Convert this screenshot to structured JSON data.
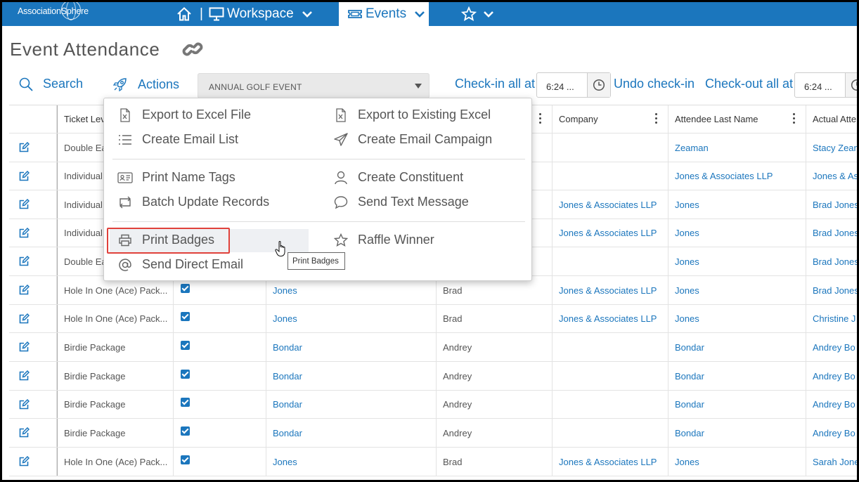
{
  "app": {
    "logo": "AssociationSphere"
  },
  "nav": {
    "workspace": "Workspace",
    "events": "Events",
    "colors": {
      "bar": "#1b76bd",
      "accent": "#1b76bd",
      "highlight": "#e0413b"
    }
  },
  "page": {
    "title": "Event Attendance"
  },
  "toolbar": {
    "search": "Search",
    "actions": "Actions",
    "event": "ANNUAL GOLF EVENT",
    "checkin_all": "Check-in all at",
    "checkin_time": "6:24 ...",
    "undo_checkin": "Undo check-in",
    "checkout_all": "Check-out all at",
    "checkout_time": "6:24 ..."
  },
  "table": {
    "headers": [
      "Ticket Lev",
      "",
      "",
      "",
      "Company",
      "Attendee Last Name",
      "Actual Atte"
    ],
    "rows": [
      {
        "ticket": "Double Ea",
        "checked": false,
        "last": "",
        "first": "",
        "company": "",
        "attendee_last": "Zeaman",
        "actual": "Stacy Zean"
      },
      {
        "ticket": "Individual",
        "checked": false,
        "last": "",
        "first": "",
        "company": "",
        "attendee_last": "Jones & Associates LLP",
        "actual": "Jones & As"
      },
      {
        "ticket": "Individual",
        "checked": false,
        "last": "",
        "first": "",
        "company": "Jones & Associates LLP",
        "attendee_last": "Jones",
        "actual": "Brad Jones"
      },
      {
        "ticket": "Individual",
        "checked": false,
        "last": "",
        "first": "",
        "company": "Jones & Associates LLP",
        "attendee_last": "Jones",
        "actual": "Brad Jones"
      },
      {
        "ticket": "Double Ea",
        "checked": false,
        "last": "",
        "first": "",
        "company": "",
        "attendee_last": "Jones",
        "actual": "Brad Jones"
      },
      {
        "ticket": "Hole In One (Ace) Pack...",
        "checked": true,
        "last": "Jones",
        "first": "Brad",
        "company": "Jones & Associates LLP",
        "attendee_last": "Jones",
        "actual": "Brad Jones"
      },
      {
        "ticket": "Hole In One (Ace) Pack...",
        "checked": true,
        "last": "Jones",
        "first": "Brad",
        "company": "Jones & Associates LLP",
        "attendee_last": "Jones",
        "actual": "Christine J"
      },
      {
        "ticket": "Birdie Package",
        "checked": true,
        "last": "Bondar",
        "first": "Andrey",
        "company": "",
        "attendee_last": "Bondar",
        "actual": "Andrey Bo"
      },
      {
        "ticket": "Birdie Package",
        "checked": true,
        "last": "Bondar",
        "first": "Andrey",
        "company": "",
        "attendee_last": "Bondar",
        "actual": "Andrey Bo"
      },
      {
        "ticket": "Birdie Package",
        "checked": true,
        "last": "Bondar",
        "first": "Andrey",
        "company": "",
        "attendee_last": "Bondar",
        "actual": "Andrey Bo"
      },
      {
        "ticket": "Birdie Package",
        "checked": true,
        "last": "Bondar",
        "first": "Andrey",
        "company": "",
        "attendee_last": "Bondar",
        "actual": "Andrey Bo"
      },
      {
        "ticket": "Hole In One (Ace) Pack...",
        "checked": true,
        "last": "Jones",
        "first": "Brad",
        "company": "Jones & Associates LLP",
        "attendee_last": "Jones",
        "actual": "Sarah Jone"
      }
    ]
  },
  "menu": {
    "left": [
      {
        "label": "Export to Excel File",
        "icon": "excel-file-icon"
      },
      {
        "label": "Create Email List",
        "icon": "list-icon"
      },
      {
        "label": "Print Name Tags",
        "icon": "name-tag-icon"
      },
      {
        "label": "Batch Update Records",
        "icon": "batch-update-icon"
      },
      {
        "label": "Print Badges",
        "icon": "printer-icon"
      },
      {
        "label": "Send Direct Email",
        "icon": "at-sign-icon"
      }
    ],
    "right": [
      {
        "label": "Export to Existing Excel",
        "icon": "excel-file-icon"
      },
      {
        "label": "Create Email Campaign",
        "icon": "paper-plane-icon"
      },
      {
        "label": "Create Constituent",
        "icon": "person-icon"
      },
      {
        "label": "Send Text Message",
        "icon": "chat-bubble-icon"
      },
      {
        "label": "Raffle Winner",
        "icon": "star-icon"
      }
    ],
    "tooltip": "Print Badges"
  }
}
